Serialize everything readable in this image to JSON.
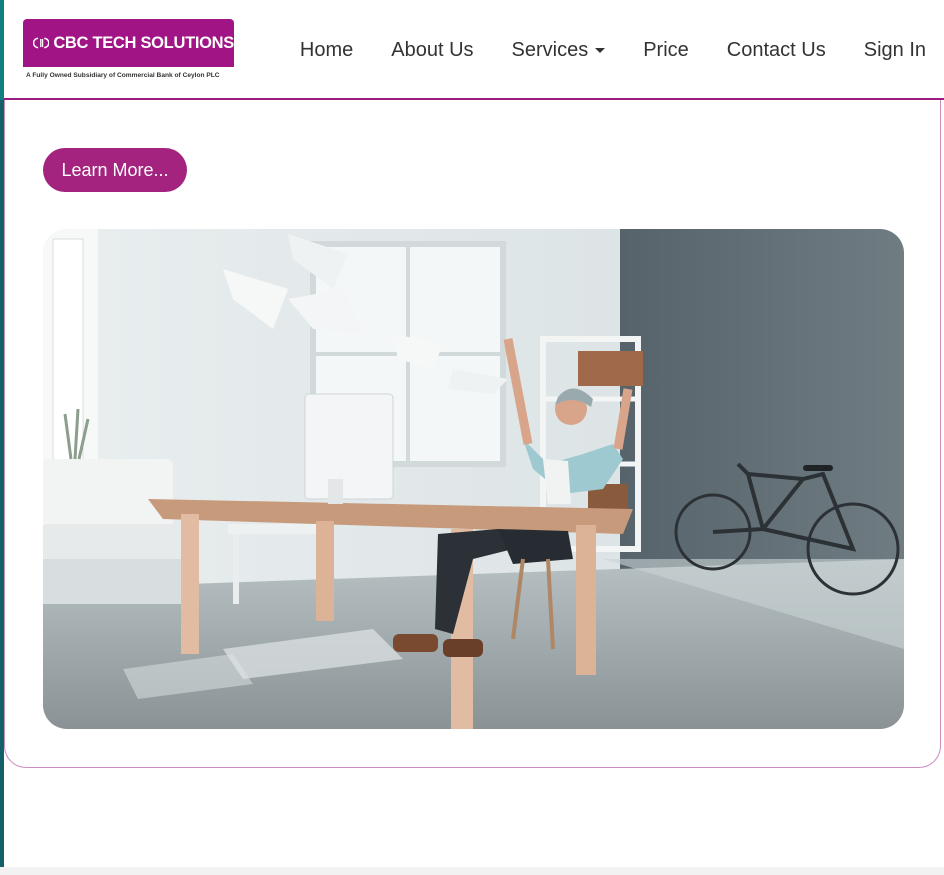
{
  "brand": {
    "name": "CBC TECH SOLUTIONS",
    "tagline": "A Fully Owned Subsidiary of Commercial Bank of Ceylon PLC",
    "color": "#a01485"
  },
  "nav": {
    "items": [
      {
        "label": "Home"
      },
      {
        "label": "About Us"
      },
      {
        "label": "Services",
        "has_dropdown": true
      },
      {
        "label": "Price"
      },
      {
        "label": "Contact Us"
      },
      {
        "label": "Sign In"
      }
    ]
  },
  "hero": {
    "cta_label": "Learn More...",
    "cta_color": "#a3237f",
    "image_description_icon": "office-photo"
  },
  "colors": {
    "accent": "#9b1b80",
    "text": "#333333"
  }
}
